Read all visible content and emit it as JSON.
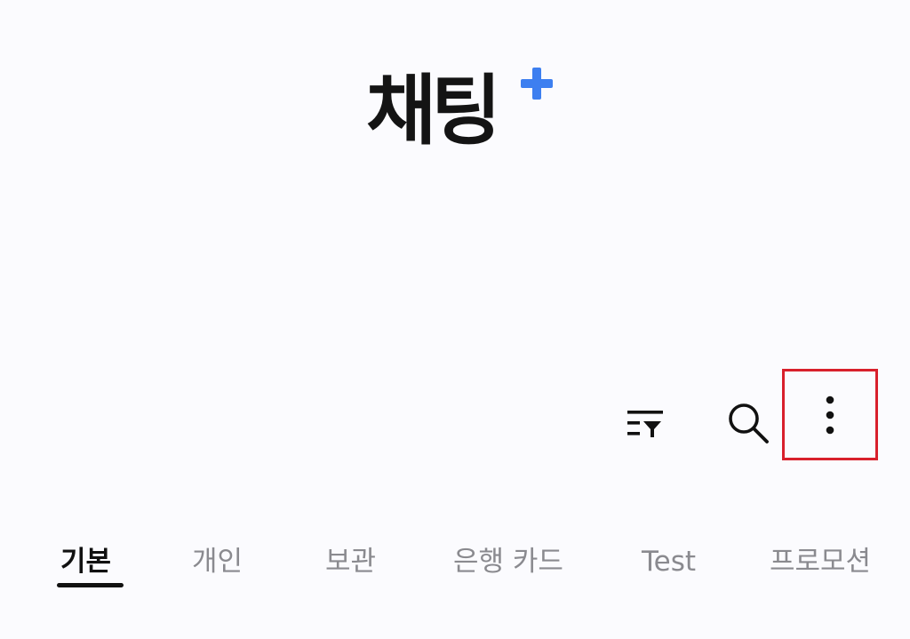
{
  "header": {
    "title": "채팅",
    "title_badge_icon": "plus-icon",
    "accent_color": "#3d7ff0"
  },
  "toolbar": {
    "icons": [
      "filter-list-icon",
      "search-icon",
      "more-vertical-icon"
    ],
    "highlight_color": "#d8202c"
  },
  "tabs": [
    {
      "label": "기본",
      "active": true
    },
    {
      "label": "개인",
      "active": false
    },
    {
      "label": "보관",
      "active": false
    },
    {
      "label": "은행 카드",
      "active": false
    },
    {
      "label": "Test",
      "active": false
    },
    {
      "label": "프로모션",
      "active": false
    }
  ]
}
